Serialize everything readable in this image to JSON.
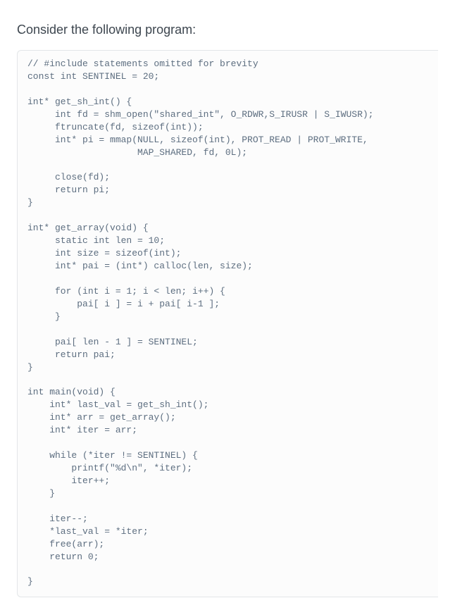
{
  "prompt": "Consider the following program:",
  "code": "// #include statements omitted for brevity\nconst int SENTINEL = 20;\n\nint* get_sh_int() {\n     int fd = shm_open(\"shared_int\", O_RDWR,S_IRUSR | S_IWUSR);\n     ftruncate(fd, sizeof(int));\n     int* pi = mmap(NULL, sizeof(int), PROT_READ | PROT_WRITE,\n                    MAP_SHARED, fd, 0L);\n\n     close(fd);\n     return pi;\n}\n\nint* get_array(void) {\n     static int len = 10;\n     int size = sizeof(int);\n     int* pai = (int*) calloc(len, size);\n\n     for (int i = 1; i < len; i++) {\n         pai[ i ] = i + pai[ i-1 ];\n     }\n\n     pai[ len - 1 ] = SENTINEL;\n     return pai;\n}\n\nint main(void) {\n    int* last_val = get_sh_int();\n    int* arr = get_array();\n    int* iter = arr;\n\n    while (*iter != SENTINEL) {\n        printf(\"%d\\n\", *iter);\n        iter++;\n    }\n\n    iter--;\n    *last_val = *iter;\n    free(arr);\n    return 0;\n\n}"
}
